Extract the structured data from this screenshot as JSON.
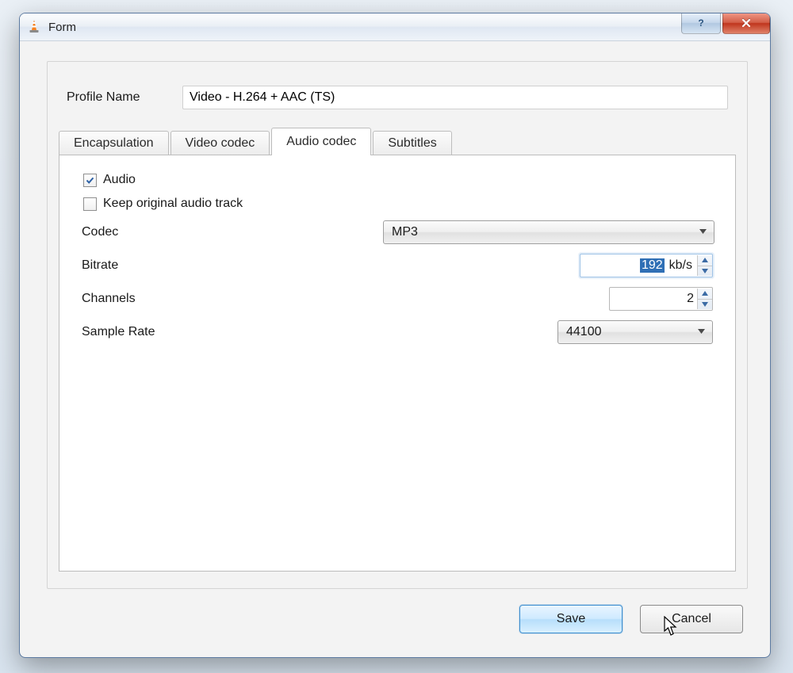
{
  "window": {
    "title": "Form",
    "help_tooltip": "Help",
    "close_tooltip": "Close"
  },
  "profile": {
    "label": "Profile Name",
    "value": "Video - H.264 + AAC (TS)"
  },
  "tabs": {
    "encapsulation": "Encapsulation",
    "video_codec": "Video codec",
    "audio_codec": "Audio codec",
    "subtitles": "Subtitles",
    "active": "audio_codec"
  },
  "audio": {
    "enable_label": "Audio",
    "enable_checked": true,
    "keep_original_label": "Keep original audio track",
    "keep_original_checked": false,
    "codec_label": "Codec",
    "codec_value": "MP3",
    "bitrate_label": "Bitrate",
    "bitrate_value": "192",
    "bitrate_unit": "kb/s",
    "channels_label": "Channels",
    "channels_value": "2",
    "sample_rate_label": "Sample Rate",
    "sample_rate_value": "44100"
  },
  "footer": {
    "save": "Save",
    "cancel": "Cancel"
  }
}
